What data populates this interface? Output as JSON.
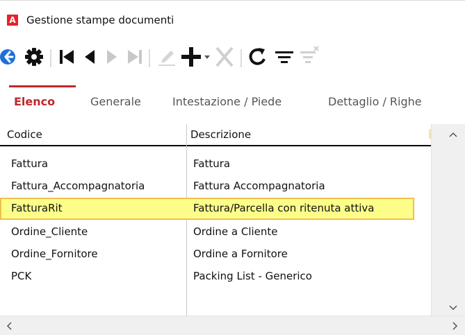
{
  "window": {
    "title": "Gestione stampe documenti",
    "app_icon_letter": "A",
    "app_icon_color": "#e8202a"
  },
  "toolbar": {
    "buttons": [
      {
        "name": "back",
        "icon": "arrow-left-circle-icon",
        "enabled": true
      },
      {
        "name": "settings",
        "icon": "gear-icon",
        "enabled": true
      },
      {
        "name": "first-record",
        "icon": "skip-first-icon",
        "enabled": true
      },
      {
        "name": "previous-record",
        "icon": "triangle-left-icon",
        "enabled": true
      },
      {
        "name": "next-record",
        "icon": "triangle-right-icon",
        "enabled": false
      },
      {
        "name": "last-record",
        "icon": "skip-last-icon",
        "enabled": false
      },
      {
        "name": "edit",
        "icon": "pencil-icon",
        "enabled": false
      },
      {
        "name": "new",
        "icon": "plus-icon",
        "enabled": true
      },
      {
        "name": "new-dropdown",
        "icon": "caret-down-icon",
        "enabled": true
      },
      {
        "name": "delete",
        "icon": "x-icon",
        "enabled": false
      },
      {
        "name": "refresh",
        "icon": "refresh-icon",
        "enabled": true
      },
      {
        "name": "filter",
        "icon": "filter-lines-icon",
        "enabled": true
      },
      {
        "name": "clear-filter",
        "icon": "filter-clear-icon",
        "enabled": false
      }
    ],
    "accent_color": "#1e6fd9"
  },
  "tabs": {
    "items": [
      {
        "label": "Elenco",
        "active": true
      },
      {
        "label": "Generale",
        "active": false
      },
      {
        "label": "Intestazione / Piede",
        "active": false
      },
      {
        "label": "Dettaglio / Righe",
        "active": false
      }
    ],
    "active_color": "#c0282c"
  },
  "grid": {
    "columns": [
      "Codice",
      "Descrizione"
    ],
    "rows": [
      {
        "codice": "Fattura",
        "descrizione": "Fattura",
        "selected": false
      },
      {
        "codice": "Fattura_Accompagnatoria",
        "descrizione": "Fattura Accompagnatoria",
        "selected": false
      },
      {
        "codice": "FatturaRit",
        "descrizione": "Fattura/Parcella con ritenuta attiva",
        "selected": true
      },
      {
        "codice": "Ordine_Cliente",
        "descrizione": "Ordine a Cliente",
        "selected": false
      },
      {
        "codice": "Ordine_Fornitore",
        "descrizione": "Ordine a Fornitore",
        "selected": false
      },
      {
        "codice": "PCK",
        "descrizione": "Packing List - Generico",
        "selected": false
      }
    ],
    "selected_row_color": "#fdfd8a",
    "selected_row_border": "#f0c14a"
  }
}
